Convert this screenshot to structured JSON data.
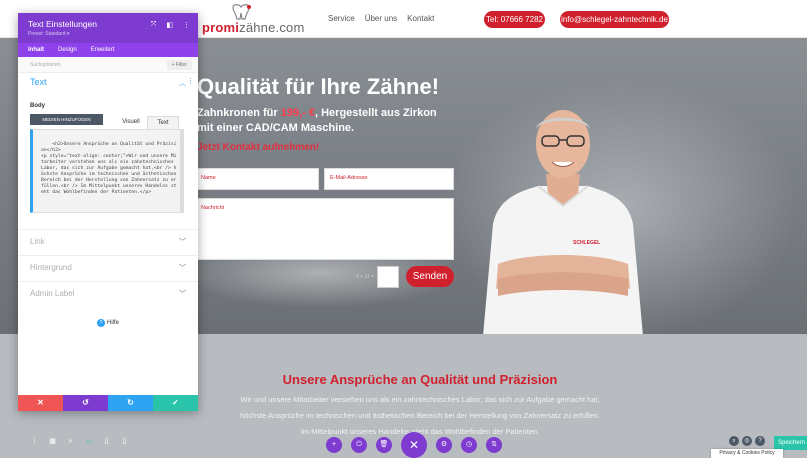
{
  "header": {
    "logo_text_a": "promi",
    "logo_text_b": "zähne.com",
    "nav": [
      "Service",
      "Über uns",
      "Kontakt"
    ],
    "phone": "Tel: 07666 7282",
    "email": "info@schlegel-zahntechnik.de"
  },
  "hero": {
    "title": "Qualität für Ihre Zähne!",
    "sub_line1_a": "Zahnkronen für ",
    "sub_price": "199,- €",
    "sub_line1_b": ", Hergestellt aus Zirkon",
    "sub_line2": "mit einer CAD/CAM Maschine.",
    "cta": "Jetzt Kontakt aufnehmen!",
    "name_placeholder": "Name",
    "email_placeholder": "E-Mail-Adresse",
    "message_placeholder": "Nachricht",
    "captcha": "4 + 11 =",
    "send_label": "Senden",
    "shirt_logo": "SCHLEGEL"
  },
  "content": {
    "title": "Unsere Ansprüche an Qualität und Präzision",
    "p1": "Wir und unsere Mitarbeiter verstehen uns als ein zahntechnisches Labor, das sich zur Aufgabe gemacht hat,",
    "p2": "höchste Ansprüche im technischen und ästhetischen Bereich bei der Herstellung von Zahnersatz zu erfüllen.",
    "p3": "Im Mittelpunkt unseres Handelns steht das Wohlbefinden der Patienten."
  },
  "panel": {
    "title": "Text Einstellungen",
    "preset": "Preset: Standard ▾",
    "tabs": [
      "Inhalt",
      "Design",
      "Erweitert"
    ],
    "search_placeholder": "Suchoptionen",
    "filter_label": "+ Filter",
    "section_text": "Text",
    "body_label": "Body",
    "media_button": "MEDIEN HINZUFÜGEN",
    "editor_tab_visual": "Visuell",
    "editor_tab_text": "Text",
    "editor_content": "<h2>Unsere Ansprüche an Qualität und Präzision</h2>\n<p style=\"text-align: center;\">Wir und unsere Mitarbeiter verstehen uns als ein zahntechnisches Labor, das sich zur Aufgabe gemacht hat,<br /> höchste Ansprüche im technischen und ästhetischen Bereich bei der Herstellung von Zahnersatz zu erfüllen.<br /> Im Mittelpunkt unseres Handelns steht das Wohlbefinden der Patienten.</p>",
    "section_link": "Link",
    "section_background": "Hintergrund",
    "section_admin": "Admin Label",
    "help_label": "Hilfe"
  },
  "footer": {
    "save_label": "Speichern",
    "privacy_label": "Privacy & Cookies Policy"
  },
  "colors": {
    "divi_purple": "#7e3bd0",
    "brand_red": "#d0202e",
    "divi_blue": "#2ea3f2",
    "save_green": "#29c4a9"
  }
}
